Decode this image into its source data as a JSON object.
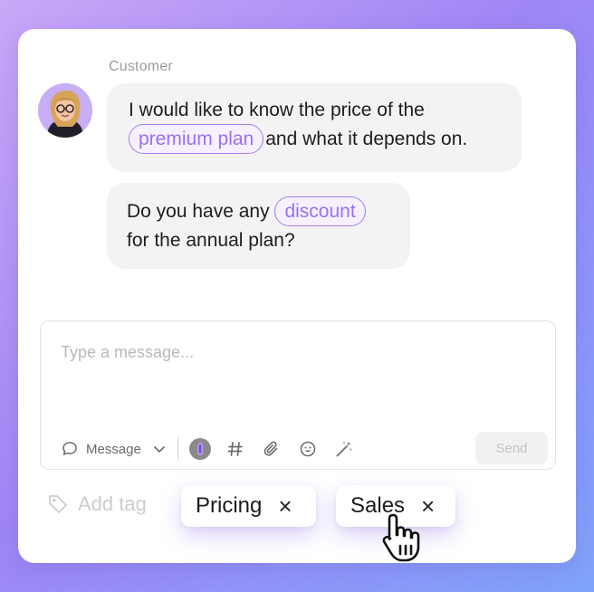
{
  "chat": {
    "sender_label": "Customer",
    "messages": [
      {
        "line1": "I would like to know the price of the",
        "chip": "premium plan",
        "line2_after_chip": "and what it depends on."
      },
      {
        "before_chip": "Do you have any",
        "chip": "discount",
        "line2": "for the annual plan?"
      }
    ]
  },
  "composer": {
    "placeholder": "Type a message...",
    "message_type": "Message",
    "send_label": "Send",
    "tools": [
      "ai-icon",
      "hashtag-icon",
      "attachment-icon",
      "emoji-icon",
      "magic-wand-icon"
    ]
  },
  "tags": {
    "add_label": "Add tag",
    "items": [
      {
        "label": "Pricing",
        "remove": "×"
      },
      {
        "label": "Sales",
        "remove": "×"
      }
    ]
  },
  "colors": {
    "accent": "#9b6fee",
    "chip_border": "#a27df0",
    "bubble_bg": "#f3f3f3"
  }
}
